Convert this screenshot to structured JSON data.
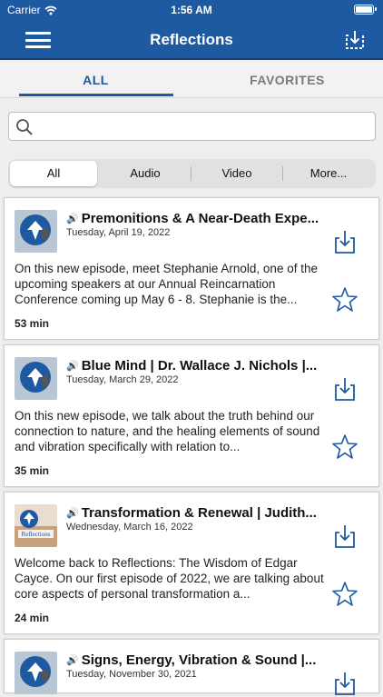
{
  "status_bar": {
    "carrier": "Carrier",
    "time": "1:56 AM"
  },
  "nav": {
    "title": "Reflections"
  },
  "tabs": {
    "all": "ALL",
    "favorites": "FAVORITES"
  },
  "search": {
    "placeholder": "",
    "value": ""
  },
  "filter": {
    "options": [
      "All",
      "Audio",
      "Video",
      "More..."
    ],
    "selected": "All"
  },
  "colors": {
    "brand": "#1e5aa1",
    "card_border": "#cfcfcf"
  },
  "episodes": [
    {
      "title": "Premonitions & A Near-Death Expe...",
      "date": "Tuesday, April 19, 2022",
      "description": "On this new episode, meet Stephanie Arnold, one of the upcoming speakers at our Annual Reincarnation Conference coming up May 6 - 8. Stephanie is the...",
      "duration": "53 min"
    },
    {
      "title": "Blue Mind | Dr. Wallace J. Nichols |...",
      "date": "Tuesday, March 29, 2022",
      "description": "On this new episode, we talk about the truth behind our connection to nature, and the healing elements of sound and vibration specifically with relation to...",
      "duration": "35 min"
    },
    {
      "title": "Transformation & Renewal | Judith...",
      "date": "Wednesday, March 16, 2022",
      "description": "Welcome back to Reflections: The Wisdom of Edgar Cayce. On our first episode of 2022, we are talking about core aspects of personal transformation a...",
      "duration": "24 min"
    },
    {
      "title": "Signs, Energy, Vibration & Sound |...",
      "date": "Tuesday, November 30, 2021",
      "description": "",
      "duration": ""
    }
  ]
}
